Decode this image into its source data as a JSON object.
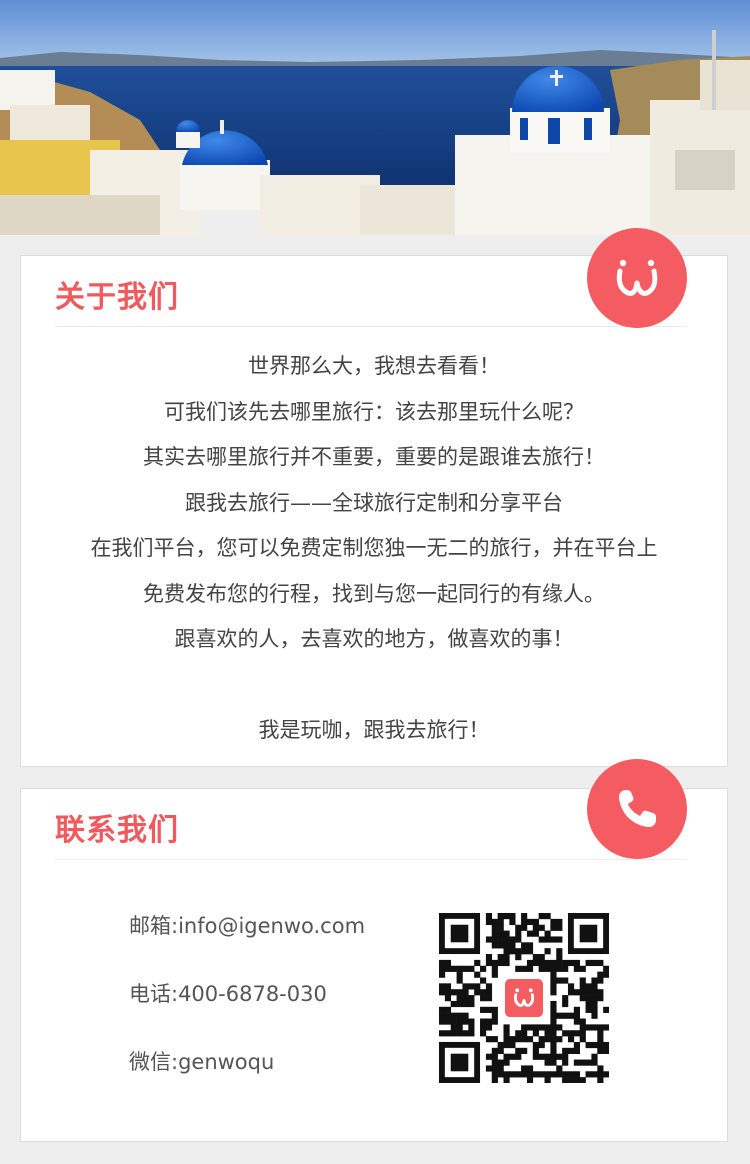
{
  "about": {
    "title": "关于我们",
    "lines": [
      "世界那么大，我想去看看！",
      "可我们该先去哪里旅行：该去那里玩什么呢？",
      "其实去哪里旅行并不重要，重要的是跟谁去旅行！",
      "跟我去旅行——全球旅行定制和分享平台",
      "在我们平台，您可以免费定制您独一无二的旅行，并在平台上",
      "免费发布您的行程，找到与您一起同行的有缘人。",
      "跟喜欢的人，去喜欢的地方，做喜欢的事！",
      "",
      "我是玩咖，跟我去旅行！"
    ],
    "badge_icon": "genwo-logo-icon"
  },
  "contact": {
    "title": "联系我们",
    "badge_icon": "phone-icon",
    "email": "邮箱:info@igenwo.com",
    "phone": "电话:400-6878-030",
    "wechat": "微信:genwoqu",
    "qr_icon": "qr-code-icon"
  },
  "colors": {
    "accent": "#f05a5e",
    "badge": "#f45c61",
    "background": "#eeeeee",
    "card": "#ffffff"
  }
}
